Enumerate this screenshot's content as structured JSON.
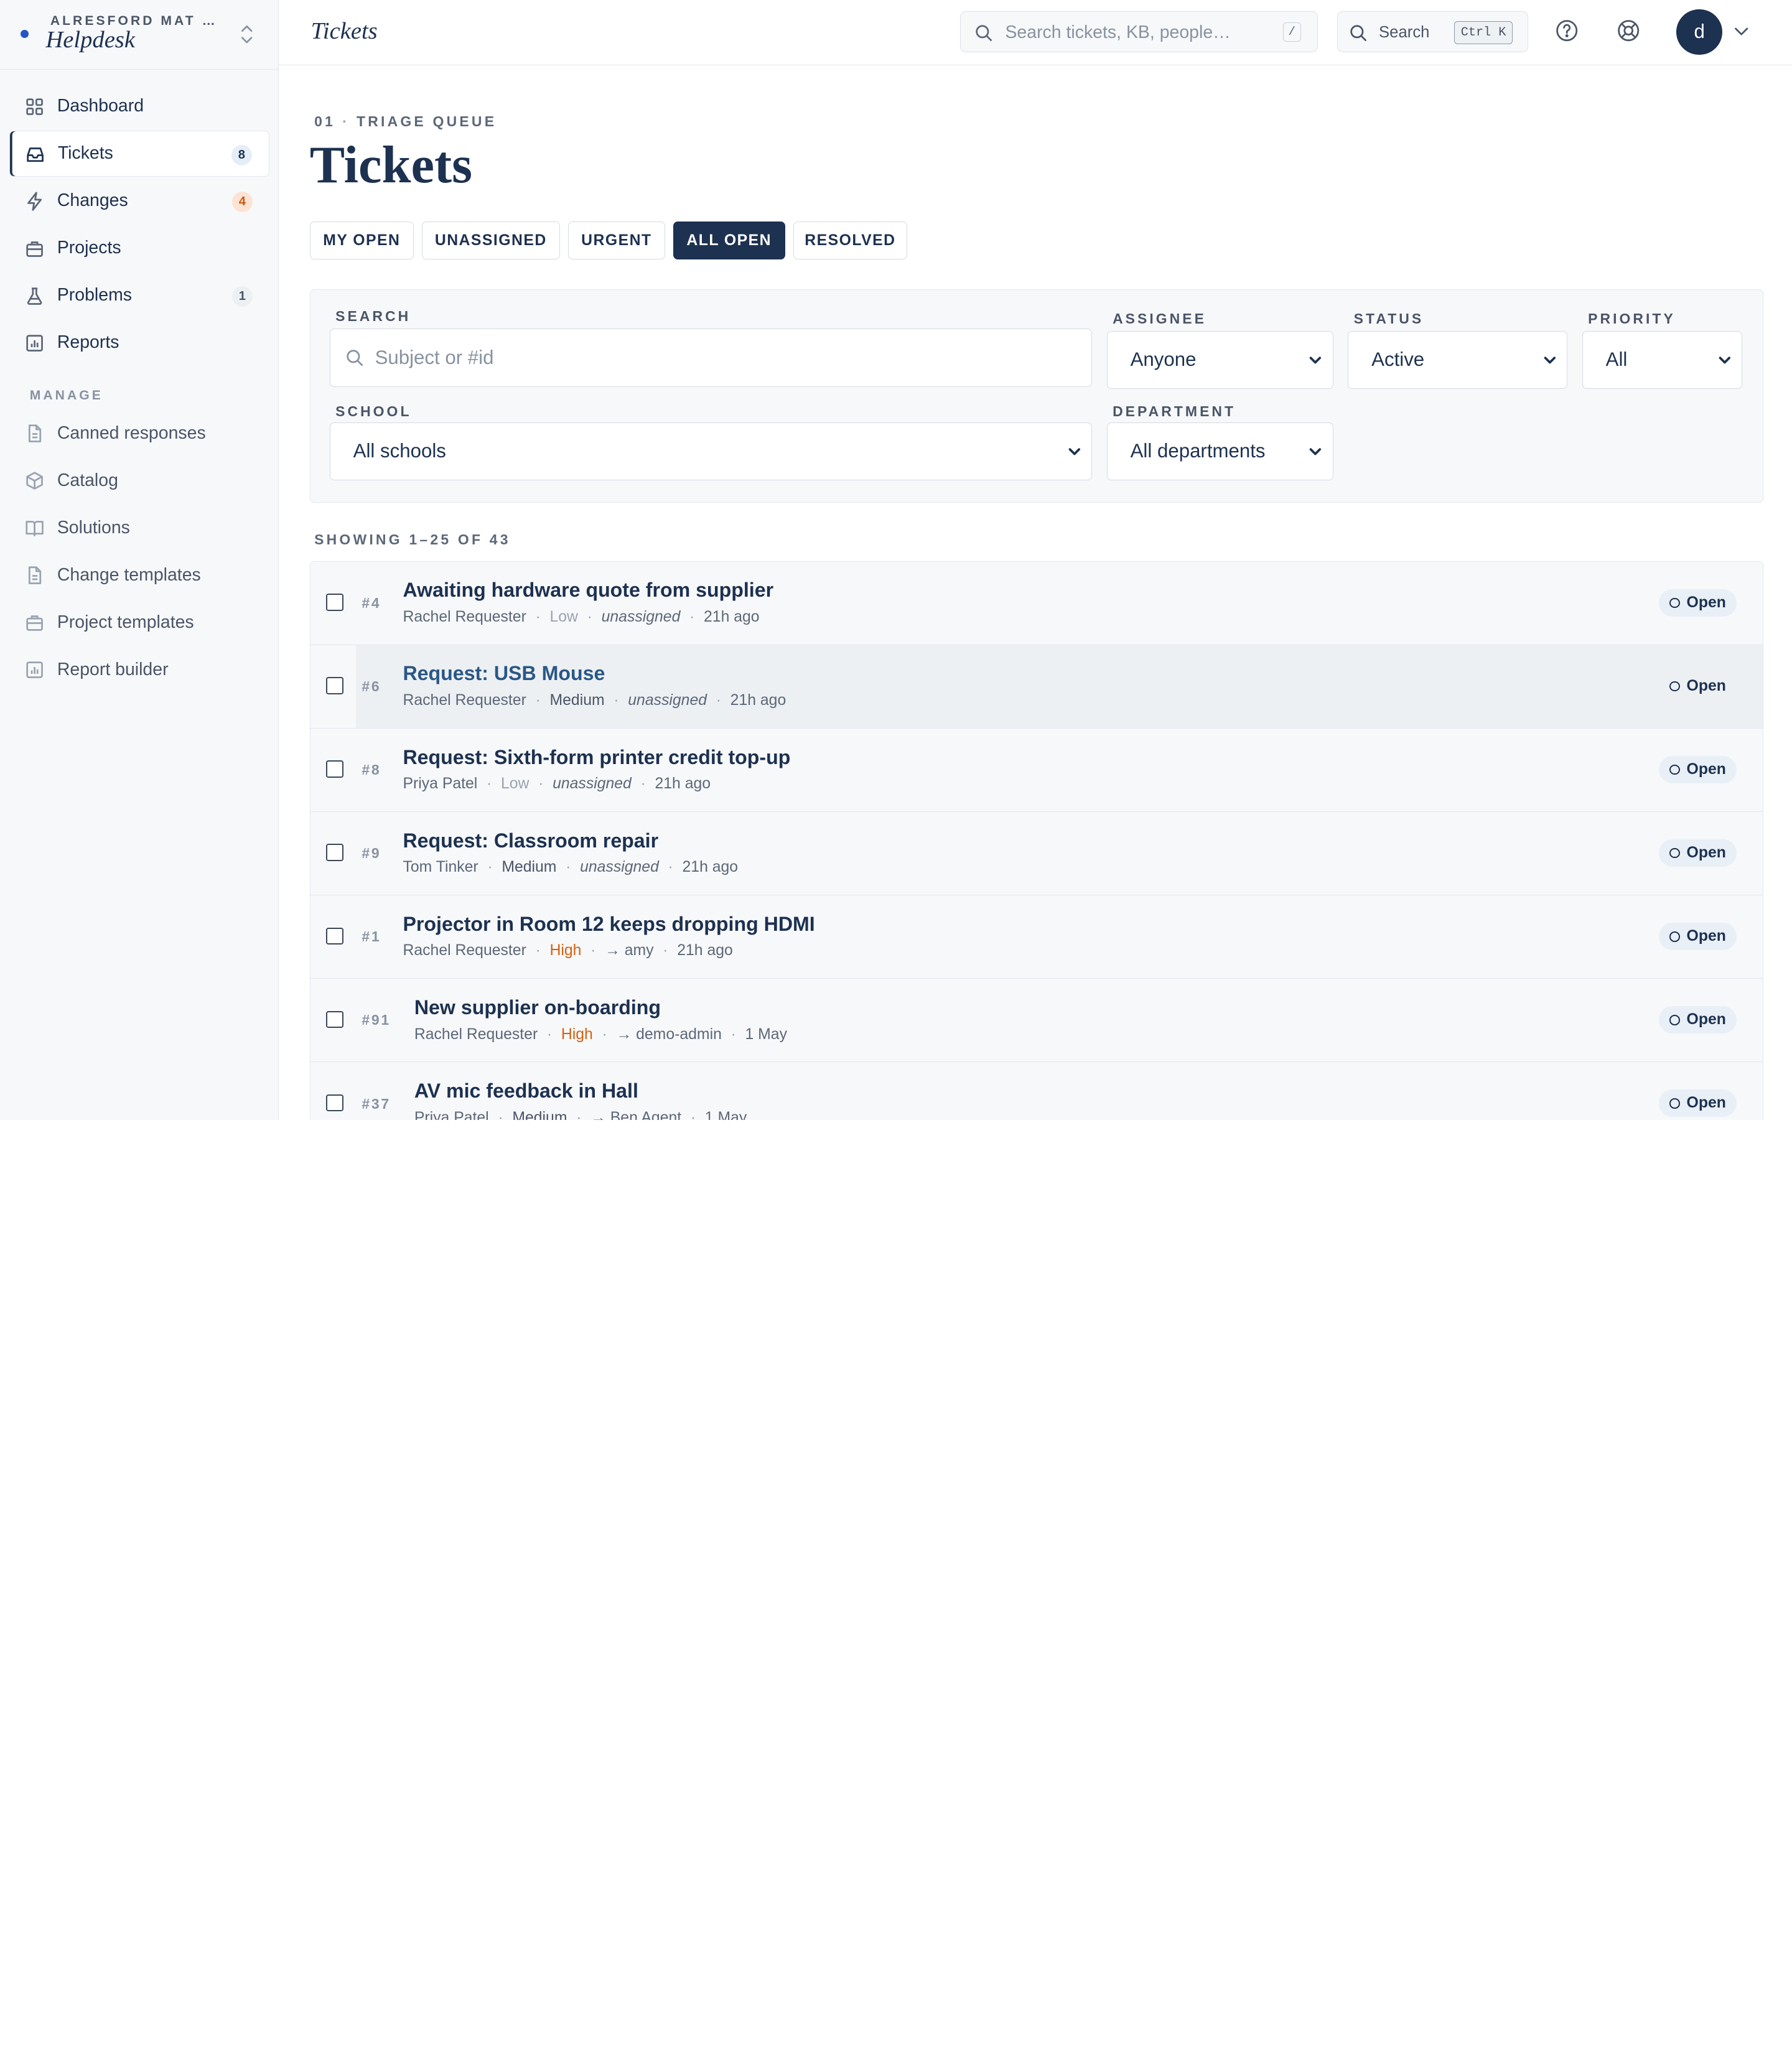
{
  "brand": {
    "org": "ALRESFORD MAT …",
    "app": "Helpdesk"
  },
  "nav": [
    {
      "label": "Dashboard",
      "icon": "grid-icon",
      "badge": null
    },
    {
      "label": "Tickets",
      "icon": "inbox-icon",
      "badge": "8",
      "active": true
    },
    {
      "label": "Changes",
      "icon": "lightning-icon",
      "badge": "4"
    },
    {
      "label": "Projects",
      "icon": "briefcase-icon",
      "badge": null
    },
    {
      "label": "Problems",
      "icon": "flask-icon",
      "badge": "1"
    },
    {
      "label": "Reports",
      "icon": "chart-icon",
      "badge": null
    }
  ],
  "manage": {
    "label": "MANAGE",
    "items": [
      {
        "label": "Canned responses",
        "icon": "document-icon"
      },
      {
        "label": "Catalog",
        "icon": "box-icon"
      },
      {
        "label": "Solutions",
        "icon": "book-icon"
      },
      {
        "label": "Change templates",
        "icon": "document-icon"
      },
      {
        "label": "Project templates",
        "icon": "briefcase-icon"
      },
      {
        "label": "Report builder",
        "icon": "chart-icon"
      }
    ]
  },
  "topbar": {
    "crumb": "Tickets",
    "search_placeholder": "Search tickets, KB, people…",
    "search_kbd": "/",
    "command_label": "Search",
    "command_kbd": "Ctrl K",
    "avatar": "d"
  },
  "page": {
    "eyebrow_num": "01",
    "eyebrow_text": "TRIAGE QUEUE",
    "title": "Tickets"
  },
  "tabs": [
    "MY OPEN",
    "UNASSIGNED",
    "URGENT",
    "ALL OPEN",
    "RESOLVED"
  ],
  "active_tab": "ALL OPEN",
  "filters": {
    "search_label": "SEARCH",
    "search_placeholder": "Subject or #id",
    "assignee_label": "ASSIGNEE",
    "assignee_value": "Anyone",
    "status_label": "STATUS",
    "status_value": "Active",
    "priority_label": "PRIORITY",
    "priority_value": "All",
    "school_label": "SCHOOL",
    "school_value": "All schools",
    "department_label": "DEPARTMENT",
    "department_value": "All departments"
  },
  "showing": "SHOWING 1–25 OF 43",
  "tickets": [
    {
      "id": "#4",
      "subject": "Awaiting hardware quote from supplier",
      "requester": "Rachel Requester",
      "priority": "Low",
      "assignee": "unassigned",
      "time": "21h ago",
      "status": "Open"
    },
    {
      "id": "#6",
      "subject": "Request: USB Mouse",
      "requester": "Rachel Requester",
      "priority": "Medium",
      "assignee": "unassigned",
      "time": "21h ago",
      "status": "Open"
    },
    {
      "id": "#8",
      "subject": "Request: Sixth-form printer credit top-up",
      "requester": "Priya Patel",
      "priority": "Low",
      "assignee": "unassigned",
      "time": "21h ago",
      "status": "Open"
    },
    {
      "id": "#9",
      "subject": "Request: Classroom repair",
      "requester": "Tom Tinker",
      "priority": "Medium",
      "assignee": "unassigned",
      "time": "21h ago",
      "status": "Open"
    },
    {
      "id": "#1",
      "subject": "Projector in Room 12 keeps dropping HDMI",
      "requester": "Rachel Requester",
      "priority": "High",
      "assignee": "→ amy",
      "time": "21h ago",
      "status": "Open"
    },
    {
      "id": "#91",
      "subject": "New supplier on-boarding",
      "requester": "Rachel Requester",
      "priority": "High",
      "assignee": "→ demo-admin",
      "time": "1 May",
      "status": "Open"
    },
    {
      "id": "#37",
      "subject": "AV mic feedback in Hall",
      "requester": "Priya Patel",
      "priority": "Medium",
      "assignee": "→ Ben Agent",
      "time": "1 May",
      "status": "Open"
    }
  ]
}
